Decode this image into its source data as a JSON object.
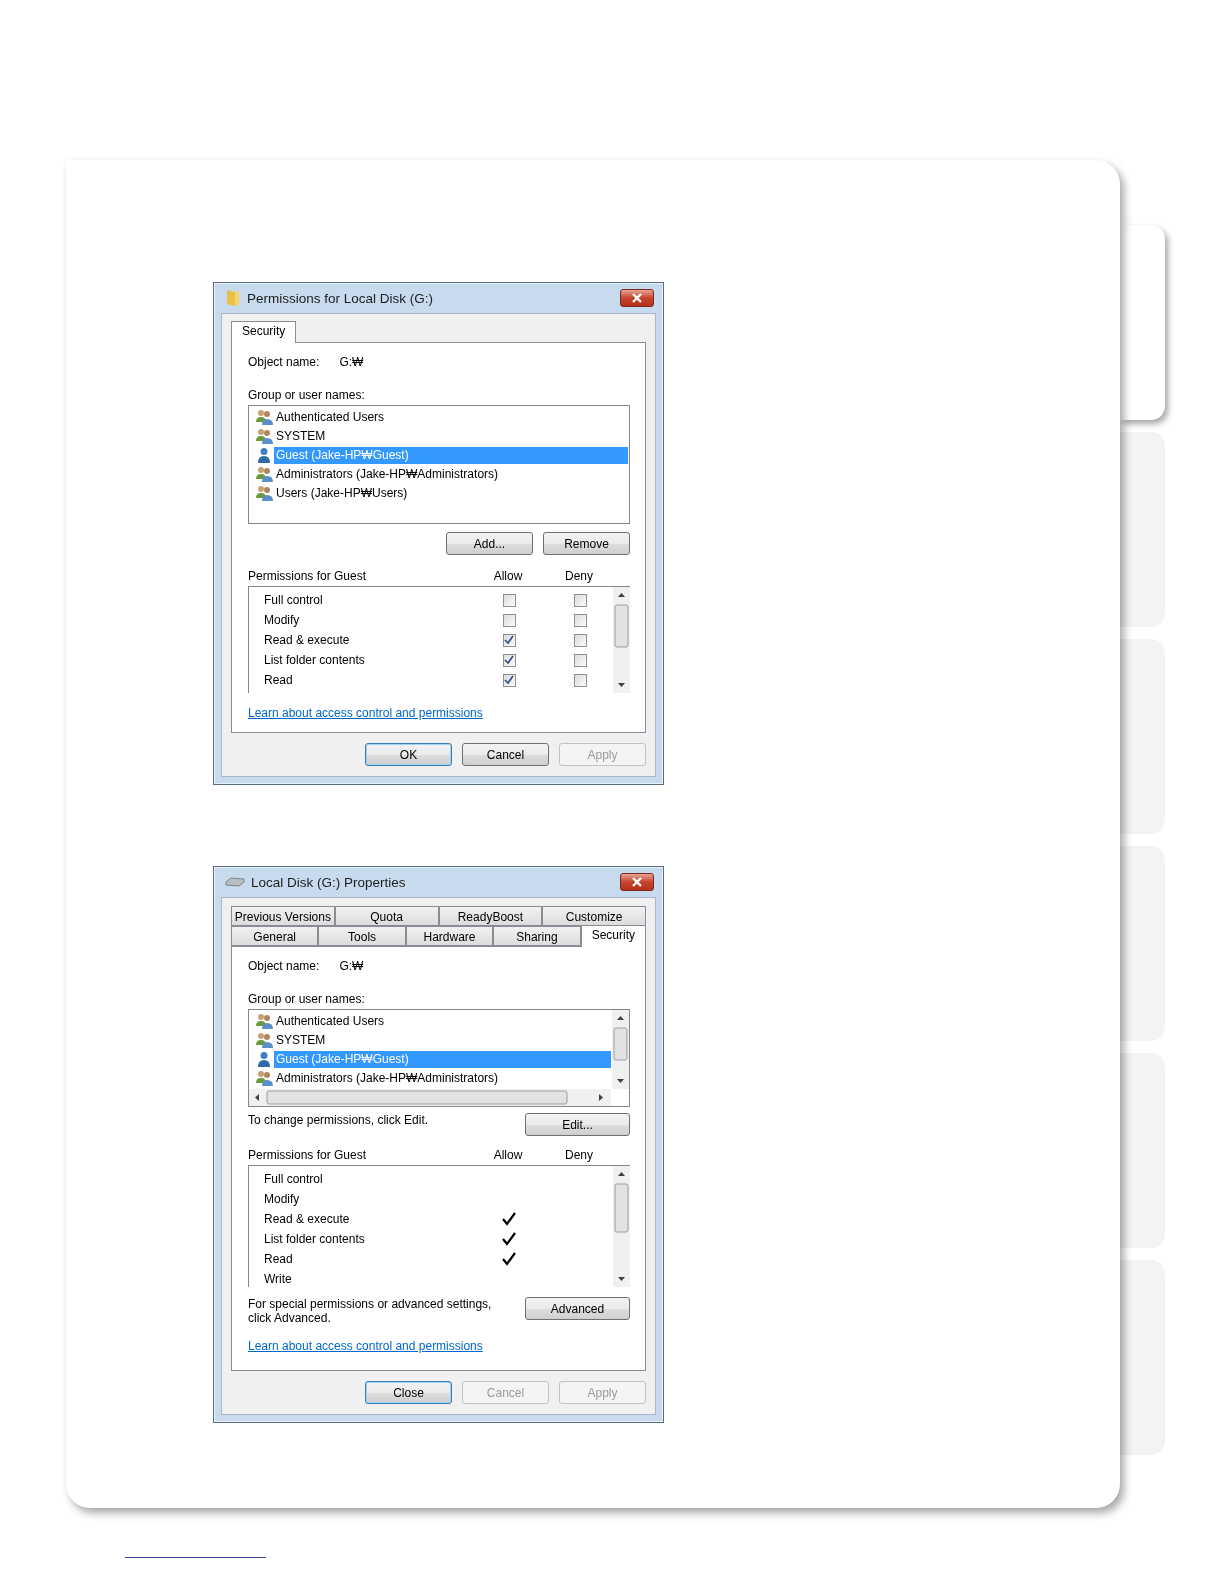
{
  "dialogs": [
    {
      "kind": "permissions",
      "title": "Permissions for Local Disk (G:)",
      "tab_rows": [
        [
          {
            "label": "Security",
            "selected": true
          }
        ]
      ],
      "object_name_label": "Object name:",
      "object_name": "G:₩",
      "group_label": "Group or user names:",
      "users": [
        {
          "name": "Authenticated Users",
          "kind": "group",
          "selected": false
        },
        {
          "name": "SYSTEM",
          "kind": "group",
          "selected": false
        },
        {
          "name": "Guest (Jake-HP₩Guest)",
          "kind": "user",
          "selected": true
        },
        {
          "name": "Administrators (Jake-HP₩Administrators)",
          "kind": "group",
          "selected": false
        },
        {
          "name": "Users (Jake-HP₩Users)",
          "kind": "group",
          "selected": false
        }
      ],
      "user_buttons": [
        "Add...",
        "Remove"
      ],
      "permissions_label": "Permissions for Guest",
      "allow_label": "Allow",
      "deny_label": "Deny",
      "permissions": [
        {
          "name": "Full control",
          "allow": false,
          "deny": false
        },
        {
          "name": "Modify",
          "allow": false,
          "deny": false
        },
        {
          "name": "Read & execute",
          "allow": true,
          "deny": false
        },
        {
          "name": "List folder contents",
          "allow": true,
          "deny": false
        },
        {
          "name": "Read",
          "allow": true,
          "deny": false
        }
      ],
      "link": "Learn about access control and permissions",
      "buttons": [
        {
          "label": "OK",
          "default": true,
          "disabled": false
        },
        {
          "label": "Cancel",
          "default": false,
          "disabled": false
        },
        {
          "label": "Apply",
          "default": false,
          "disabled": true
        }
      ]
    },
    {
      "kind": "properties",
      "title": "Local Disk (G:) Properties",
      "tab_rows": [
        [
          {
            "label": "Previous Versions",
            "selected": false
          },
          {
            "label": "Quota",
            "selected": false
          },
          {
            "label": "ReadyBoost",
            "selected": false
          },
          {
            "label": "Customize",
            "selected": false
          }
        ],
        [
          {
            "label": "General",
            "selected": false
          },
          {
            "label": "Tools",
            "selected": false
          },
          {
            "label": "Hardware",
            "selected": false
          },
          {
            "label": "Sharing",
            "selected": false
          },
          {
            "label": "Security",
            "selected": true
          }
        ]
      ],
      "object_name_label": "Object name:",
      "object_name": "G:₩",
      "group_label": "Group or user names:",
      "users": [
        {
          "name": "Authenticated Users",
          "kind": "group",
          "selected": false
        },
        {
          "name": "SYSTEM",
          "kind": "group",
          "selected": false
        },
        {
          "name": "Guest (Jake-HP₩Guest)",
          "kind": "user",
          "selected": true
        },
        {
          "name": "Administrators (Jake-HP₩Administrators)",
          "kind": "group",
          "selected": false
        }
      ],
      "change_text": "To change permissions, click Edit.",
      "edit_button": "Edit...",
      "permissions_label": "Permissions for Guest",
      "allow_label": "Allow",
      "deny_label": "Deny",
      "permissions": [
        {
          "name": "Full control",
          "allow": false,
          "deny": false
        },
        {
          "name": "Modify",
          "allow": false,
          "deny": false
        },
        {
          "name": "Read & execute",
          "allow": true,
          "deny": false
        },
        {
          "name": "List folder contents",
          "allow": true,
          "deny": false
        },
        {
          "name": "Read",
          "allow": true,
          "deny": false
        },
        {
          "name": "Write",
          "allow": false,
          "deny": false
        }
      ],
      "advanced_text": "For special permissions or advanced settings, click Advanced.",
      "advanced_button": "Advanced",
      "link": "Learn about access control and permissions",
      "buttons": [
        {
          "label": "Close",
          "default": true,
          "disabled": false
        },
        {
          "label": "Cancel",
          "default": false,
          "disabled": true
        },
        {
          "label": "Apply",
          "default": false,
          "disabled": true
        }
      ]
    }
  ]
}
